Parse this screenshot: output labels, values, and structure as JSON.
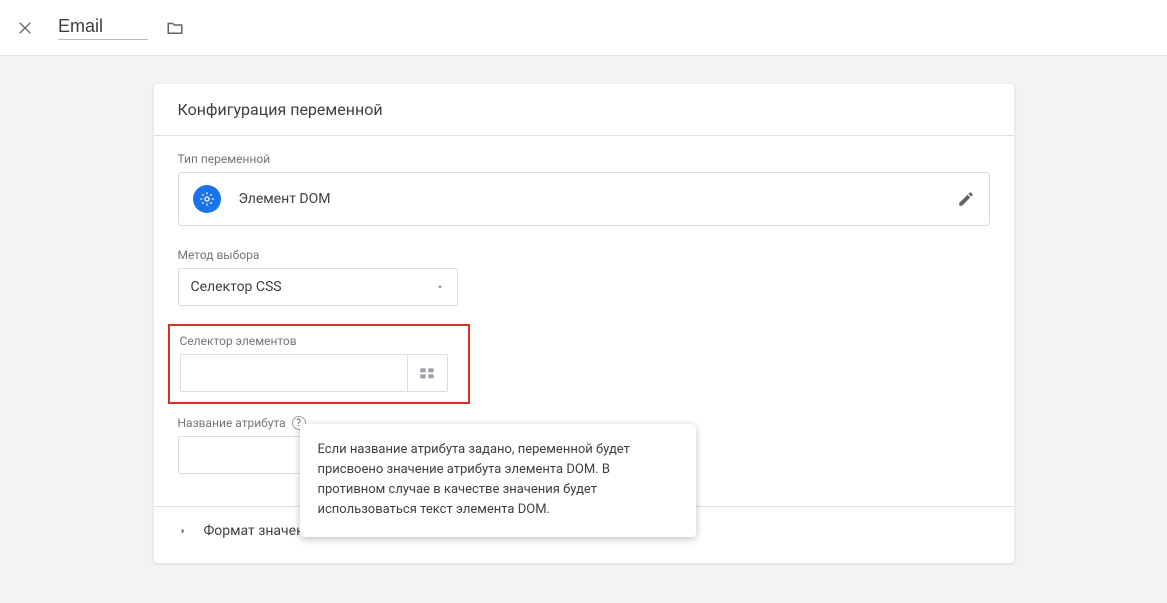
{
  "topbar": {
    "title_value": "Email"
  },
  "card": {
    "header": "Конфигурация переменной",
    "type_section_label": "Тип переменной",
    "type_name": "Элемент DOM",
    "method_label": "Метод выбора",
    "method_value": "Селектор CSS",
    "selector_label": "Селектор элементов",
    "selector_value": "",
    "attribute_label": "Название атрибута",
    "attribute_value": "",
    "expander_label": "Формат значения",
    "help_tooltip": "Если название атрибута задано, переменной будет присвоено значение атрибута элемента DOM. В противном случае в качестве значения будет использоваться текст элемента DOM."
  }
}
